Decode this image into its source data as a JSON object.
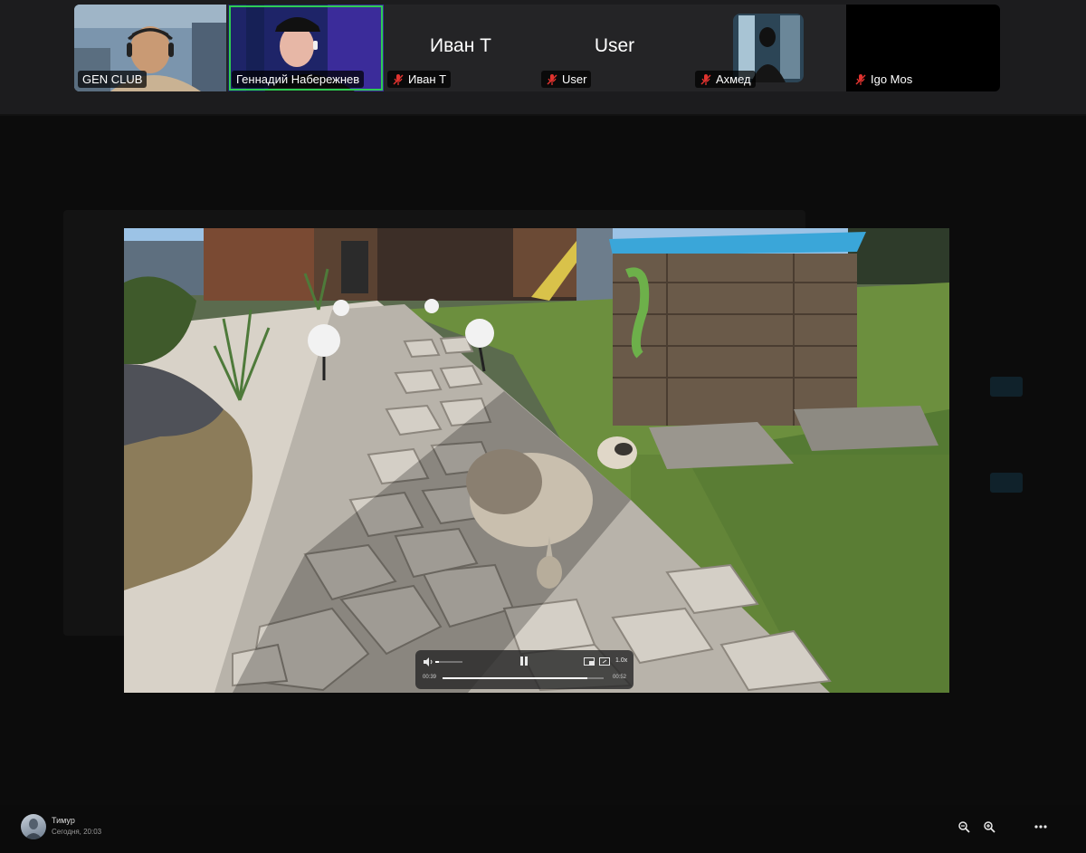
{
  "participants": [
    {
      "name": "GEN CLUB",
      "muted": false,
      "video": true
    },
    {
      "name": "Геннадий Набережнев",
      "muted": false,
      "video": true,
      "active_speaker": true
    },
    {
      "name": "Иван Т",
      "display_text": "Иван Т",
      "muted": true,
      "video": false
    },
    {
      "name": "User",
      "display_text": "User",
      "muted": true,
      "video": false
    },
    {
      "name": "Ахмед",
      "muted": true,
      "video": true
    },
    {
      "name": "Igo Mos",
      "muted": true,
      "video": false
    }
  ],
  "player": {
    "current_time": "00:39",
    "total_time": "00:52",
    "speed": "1.0x",
    "progress": 0.9
  },
  "message": {
    "author": "Тимур",
    "timestamp": "Сегодня, 20:03"
  },
  "colors": {
    "active_speaker_border": "#2ecc52",
    "mute_icon": "#e0332f",
    "strip_bg": "#1c1c1e"
  },
  "icons": {
    "mute": "microphone-off-icon",
    "zoom_out": "zoom-out-icon",
    "zoom_in": "zoom-in-icon",
    "more": "more-options-icon"
  }
}
